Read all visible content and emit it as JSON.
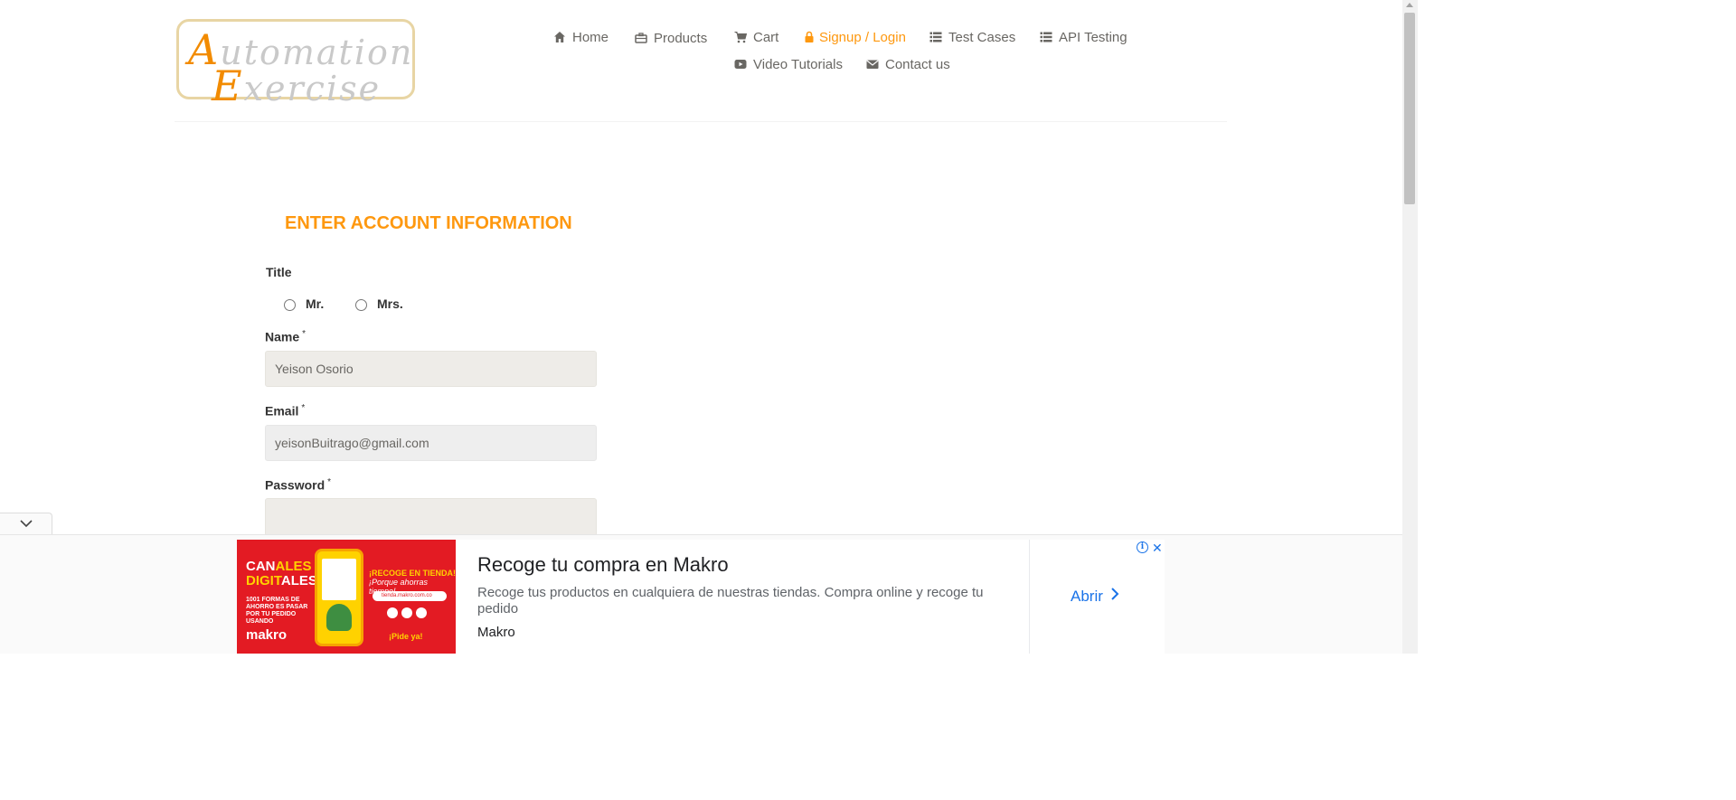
{
  "logo": {
    "line1_cap": "A",
    "line1_rest": "utomation",
    "line2_cap": "E",
    "line2_rest": "xercise"
  },
  "nav": {
    "home": "Home",
    "products": "Products",
    "cart": "Cart",
    "signup": "Signup / Login",
    "test_cases": "Test Cases",
    "api_testing": "API Testing",
    "video_tutorials": "Video Tutorials",
    "contact": "Contact us"
  },
  "form": {
    "heading": "ENTER ACCOUNT INFORMATION",
    "title_label": "Title",
    "title_options": [
      "Mr.",
      "Mrs."
    ],
    "name_label": "Name",
    "name_value": "Yeison Osorio",
    "email_label": "Email",
    "email_value": "yeisonBuitrago@gmail.com",
    "password_label": "Password",
    "password_value": "",
    "required_mark": "*"
  },
  "ad": {
    "image": {
      "canales_1": "CAN",
      "canales_1b": "ALES",
      "canales_2": "DIGIT",
      "canales_2b": "ALES",
      "small_text": "1001 FORMAS DE AHORRO ES PASAR POR TU PEDIDO USANDO",
      "brand_logo": "makro",
      "recoge": "¡RECOGE EN TIENDA!",
      "recoge_sub": "¡Porque ahorras tiempo!",
      "url": "tienda.makro.com.co",
      "pide": "¡Pide ya!"
    },
    "headline": "Recoge tu compra en Makro",
    "description": "Recoge tus productos en cualquiera de nuestras tiendas. Compra online y recoge tu pedido",
    "brand": "Makro",
    "cta": "Abrir"
  },
  "colors": {
    "accent": "#fe980f",
    "ad_red": "#e31b23",
    "link_blue": "#1a73e8"
  }
}
